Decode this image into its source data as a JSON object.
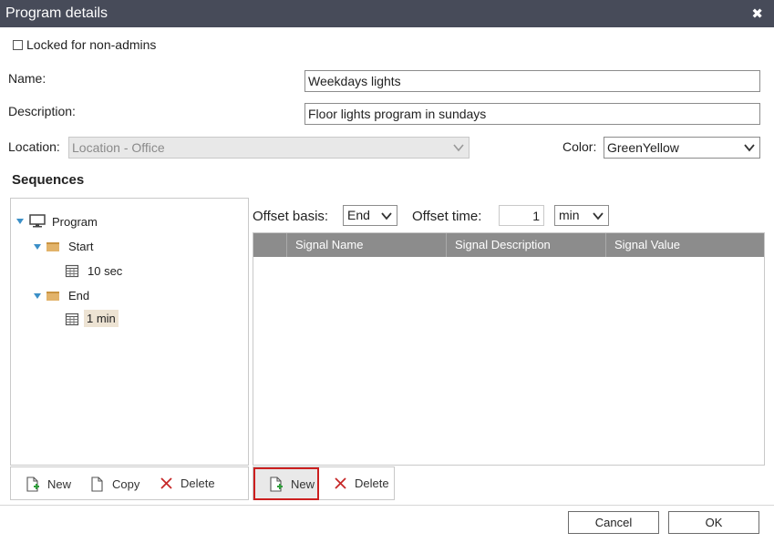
{
  "dialog": {
    "title": "Program details",
    "close_glyph": "✖"
  },
  "locked": {
    "label": "Locked for non-admins",
    "checked": false
  },
  "form": {
    "name_label": "Name:",
    "name_value": "Weekdays lights",
    "description_label": "Description:",
    "description_value": "Floor lights program in sundays",
    "location_label": "Location:",
    "location_value": "Location - Office",
    "color_label": "Color:",
    "color_value": "GreenYellow"
  },
  "sequences": {
    "title": "Sequences",
    "tree": {
      "root": "Program",
      "groups": [
        {
          "label": "Start",
          "children": [
            "10 sec"
          ]
        },
        {
          "label": "End",
          "children": [
            "1 min"
          ]
        }
      ],
      "selected": "1 min"
    },
    "toolbar": {
      "new": "New",
      "copy": "Copy",
      "delete": "Delete"
    }
  },
  "offset": {
    "basis_label": "Offset basis:",
    "basis_value": "End",
    "time_label": "Offset time:",
    "time_value": "1",
    "unit_value": "min"
  },
  "signals": {
    "columns": [
      "Signal Name",
      "Signal Description",
      "Signal Value"
    ],
    "rows": [],
    "toolbar": {
      "new": "New",
      "delete": "Delete"
    }
  },
  "footer": {
    "cancel": "Cancel",
    "ok": "OK"
  },
  "colors": {
    "titlebar": "#474b59",
    "grid_header": "#8c8c8c",
    "highlight_border": "#cc1f1f",
    "tree_arrow": "#3b8fc7"
  }
}
